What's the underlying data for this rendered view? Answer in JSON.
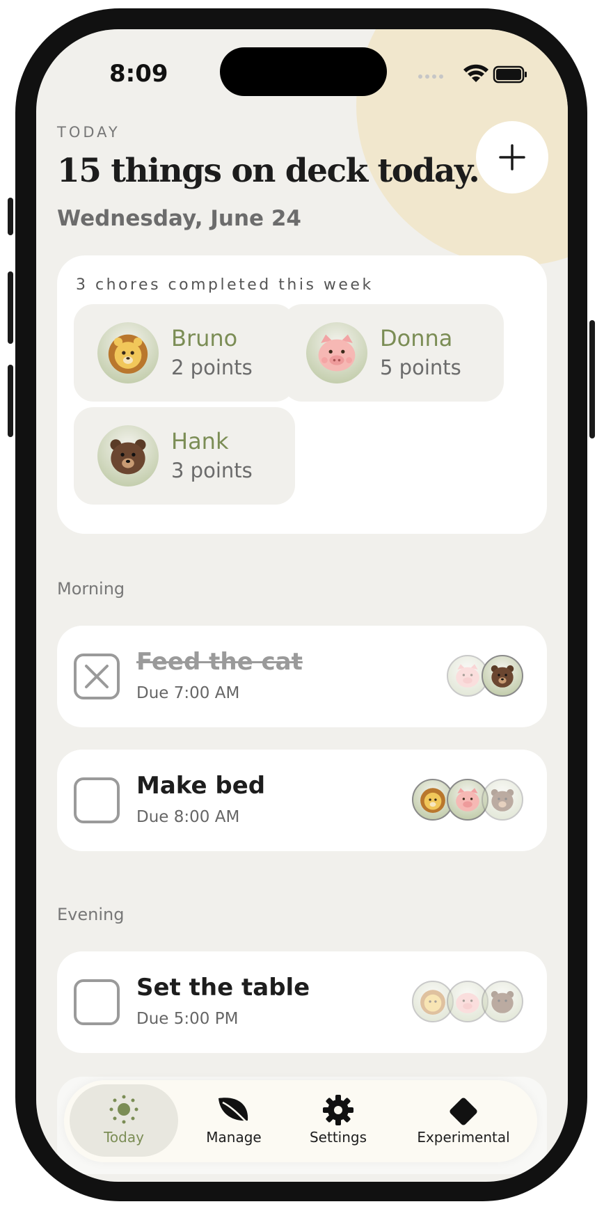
{
  "status_bar": {
    "time": "8:09"
  },
  "header": {
    "eyebrow": "TODAY",
    "headline": "15 things on deck today.",
    "date": "Wednesday, June 24"
  },
  "summary": {
    "title": "3 chores completed this week",
    "people": [
      {
        "name": "Bruno",
        "points": "2 points",
        "animal": "lion-icon"
      },
      {
        "name": "Donna",
        "points": "5 points",
        "animal": "pig-icon"
      },
      {
        "name": "Hank",
        "points": "3 points",
        "animal": "bear-icon"
      }
    ]
  },
  "sections": [
    {
      "label": "Morning",
      "chores": [
        {
          "title": "Feed the cat",
          "due": "Due 7:00 AM",
          "done": true,
          "assignees": [
            "Donna",
            "Hank"
          ]
        },
        {
          "title": "Make bed",
          "due": "Due 8:00 AM",
          "done": false,
          "assignees": [
            "Bruno",
            "Donna",
            "Hank"
          ]
        }
      ]
    },
    {
      "label": "Evening",
      "chores": [
        {
          "title": "Set the table",
          "due": "Due 5:00 PM",
          "done": false,
          "assignees": [
            "Bruno",
            "Donna",
            "Hank"
          ]
        }
      ]
    }
  ],
  "tabbar": {
    "tabs": [
      {
        "label": "Today",
        "icon": "sun-icon",
        "active": true
      },
      {
        "label": "Manage",
        "icon": "leaf-icon",
        "active": false
      },
      {
        "label": "Settings",
        "icon": "gear-icon",
        "active": false
      },
      {
        "label": "Experimental",
        "icon": "diamond-icon",
        "active": false
      }
    ]
  },
  "colors": {
    "accent": "#7b8d55",
    "background": "#f1f0ec",
    "sun_blob": "#f1e7cd"
  }
}
